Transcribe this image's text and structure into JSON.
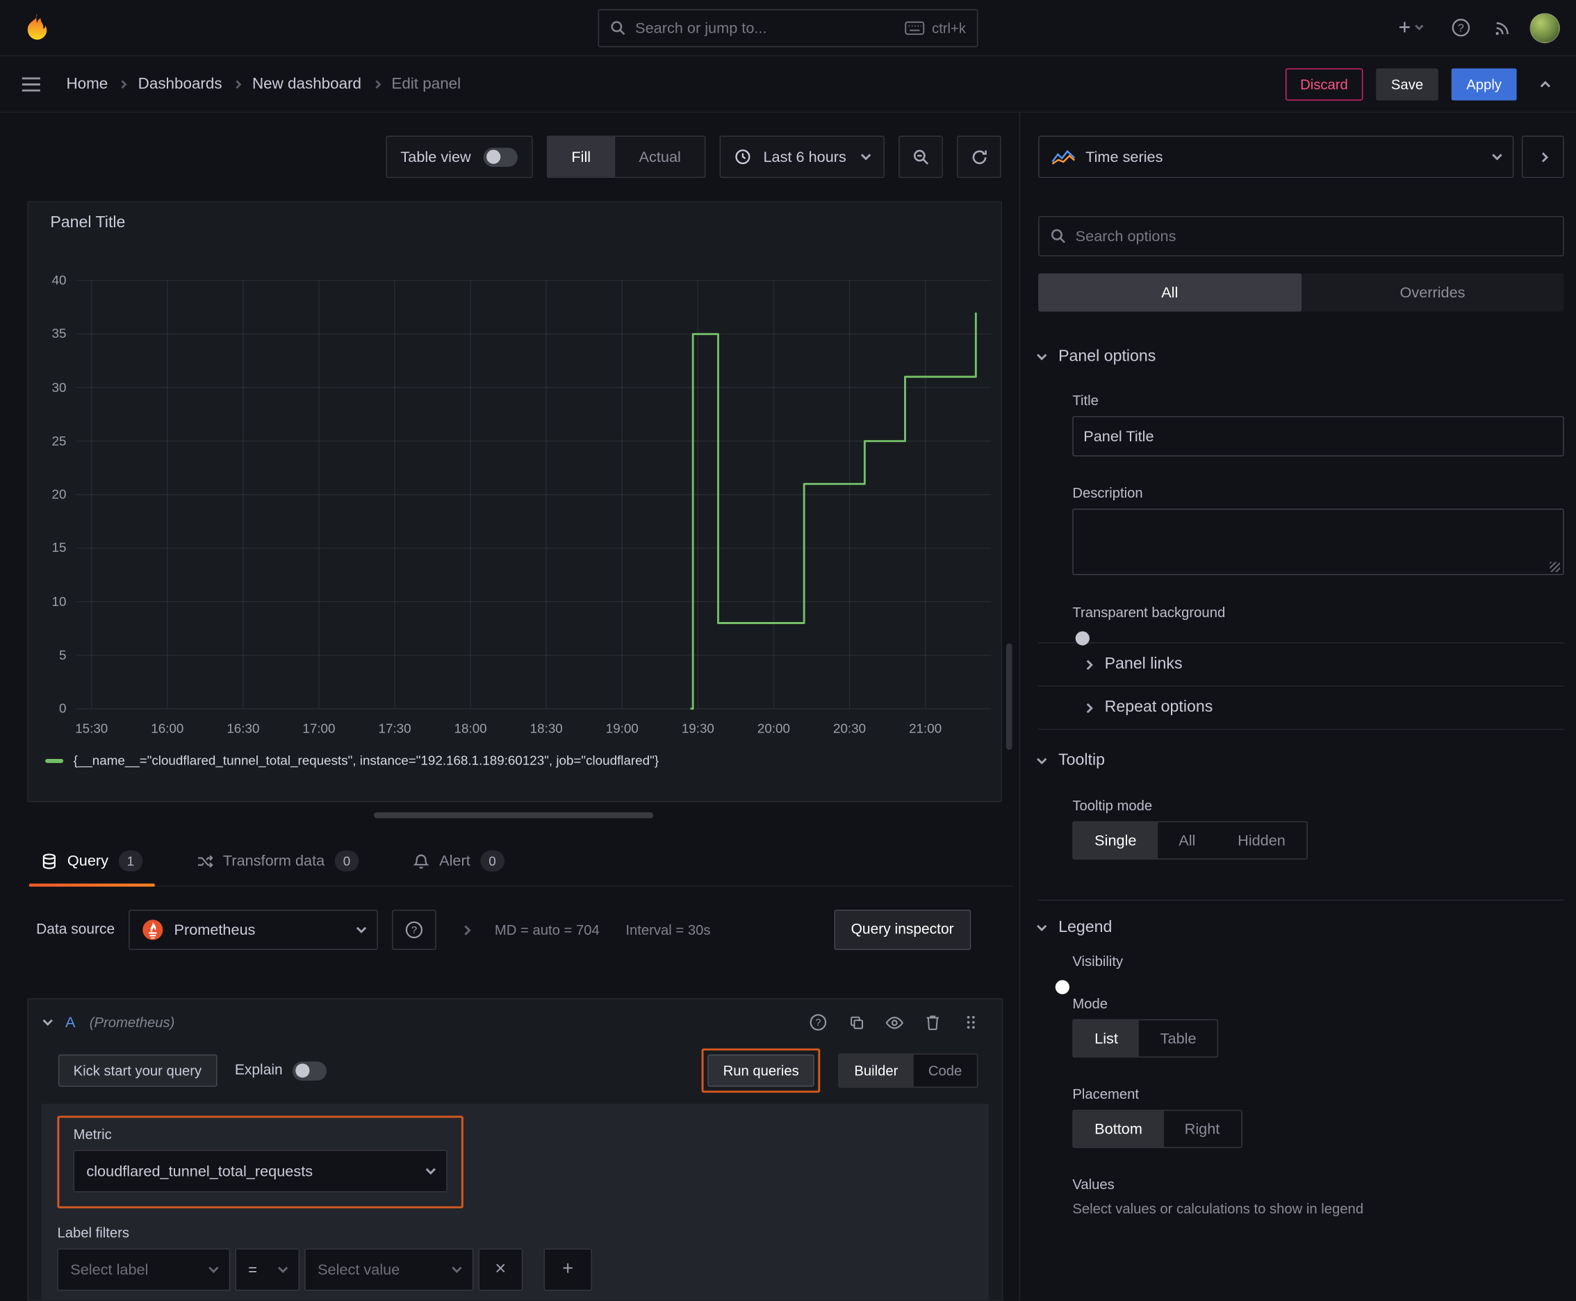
{
  "topbar": {
    "search_placeholder": "Search or jump to...",
    "search_shortcut": "ctrl+k"
  },
  "breadcrumbs": {
    "items": [
      "Home",
      "Dashboards",
      "New dashboard",
      "Edit panel"
    ]
  },
  "header_actions": {
    "discard": "Discard",
    "save": "Save",
    "apply": "Apply"
  },
  "toolbar": {
    "table_view": "Table view",
    "fill": "Fill",
    "actual": "Actual",
    "time_range": "Last 6 hours"
  },
  "panel": {
    "title": "Panel Title"
  },
  "chart_data": {
    "type": "line",
    "step": "after",
    "title": "Panel Title",
    "grid": true,
    "legend_position": "bottom",
    "x_ticks": [
      "15:30",
      "16:00",
      "16:30",
      "17:00",
      "17:30",
      "18:00",
      "18:30",
      "19:00",
      "19:30",
      "20:00",
      "20:30",
      "21:00"
    ],
    "x_domain": [
      "15:24",
      "21:26"
    ],
    "y_ticks": [
      0,
      5,
      10,
      15,
      20,
      25,
      30,
      35,
      40
    ],
    "ylim": [
      0,
      40
    ],
    "series": [
      {
        "name": "{__name__=\"cloudflared_tunnel_total_requests\", instance=\"192.168.1.189:60123\", job=\"cloudflared\"}",
        "color": "#73bf69",
        "points": [
          [
            "19:27",
            0
          ],
          [
            "19:28",
            35
          ],
          [
            "19:38",
            8
          ],
          [
            "20:12",
            21
          ],
          [
            "20:36",
            25
          ],
          [
            "20:52",
            31
          ],
          [
            "21:20",
            37
          ]
        ]
      }
    ]
  },
  "editor_tabs": [
    {
      "label": "Query",
      "count": "1"
    },
    {
      "label": "Transform data",
      "count": "0"
    },
    {
      "label": "Alert",
      "count": "0"
    }
  ],
  "datasource_row": {
    "label": "Data source",
    "name": "Prometheus",
    "max_data_points": "MD = auto = 704",
    "interval": "Interval = 30s",
    "query_inspector": "Query inspector"
  },
  "query": {
    "ref_id": "A",
    "datasource_hint": "(Prometheus)",
    "kick_start": "Kick start your query",
    "explain": "Explain",
    "run_queries": "Run queries",
    "builder": "Builder",
    "code": "Code",
    "metric_label": "Metric",
    "metric_value": "cloudflared_tunnel_total_requests",
    "label_filters": "Label filters",
    "select_label_placeholder": "Select label",
    "operator": "=",
    "select_value_placeholder": "Select value"
  },
  "options_pane": {
    "visualization": "Time series",
    "search_placeholder": "Search options",
    "tab_all": "All",
    "tab_overrides": "Overrides",
    "panel_options": {
      "heading": "Panel options",
      "title_label": "Title",
      "title_value": "Panel Title",
      "description_label": "Description",
      "transparent_label": "Transparent background",
      "panel_links": "Panel links",
      "repeat_options": "Repeat options"
    },
    "tooltip": {
      "heading": "Tooltip",
      "mode_label": "Tooltip mode",
      "options": [
        "Single",
        "All",
        "Hidden"
      ],
      "selected": "Single"
    },
    "legend": {
      "heading": "Legend",
      "visibility_label": "Visibility",
      "mode_label": "Mode",
      "mode_options": [
        "List",
        "Table"
      ],
      "mode_selected": "List",
      "placement_label": "Placement",
      "placement_options": [
        "Bottom",
        "Right"
      ],
      "placement_selected": "Bottom",
      "values_label": "Values",
      "values_description": "Select values or calculations to show in legend"
    }
  },
  "icons": {
    "add": "+",
    "remove": "×",
    "help": "?"
  },
  "colors": {
    "accent_blue": "#3d71d9",
    "destructive": "#ff5286",
    "highlight_orange": "#d65a1f",
    "series_green": "#73bf69",
    "tab_indicator": "#ff780a",
    "query_ref": "#5794f2"
  }
}
